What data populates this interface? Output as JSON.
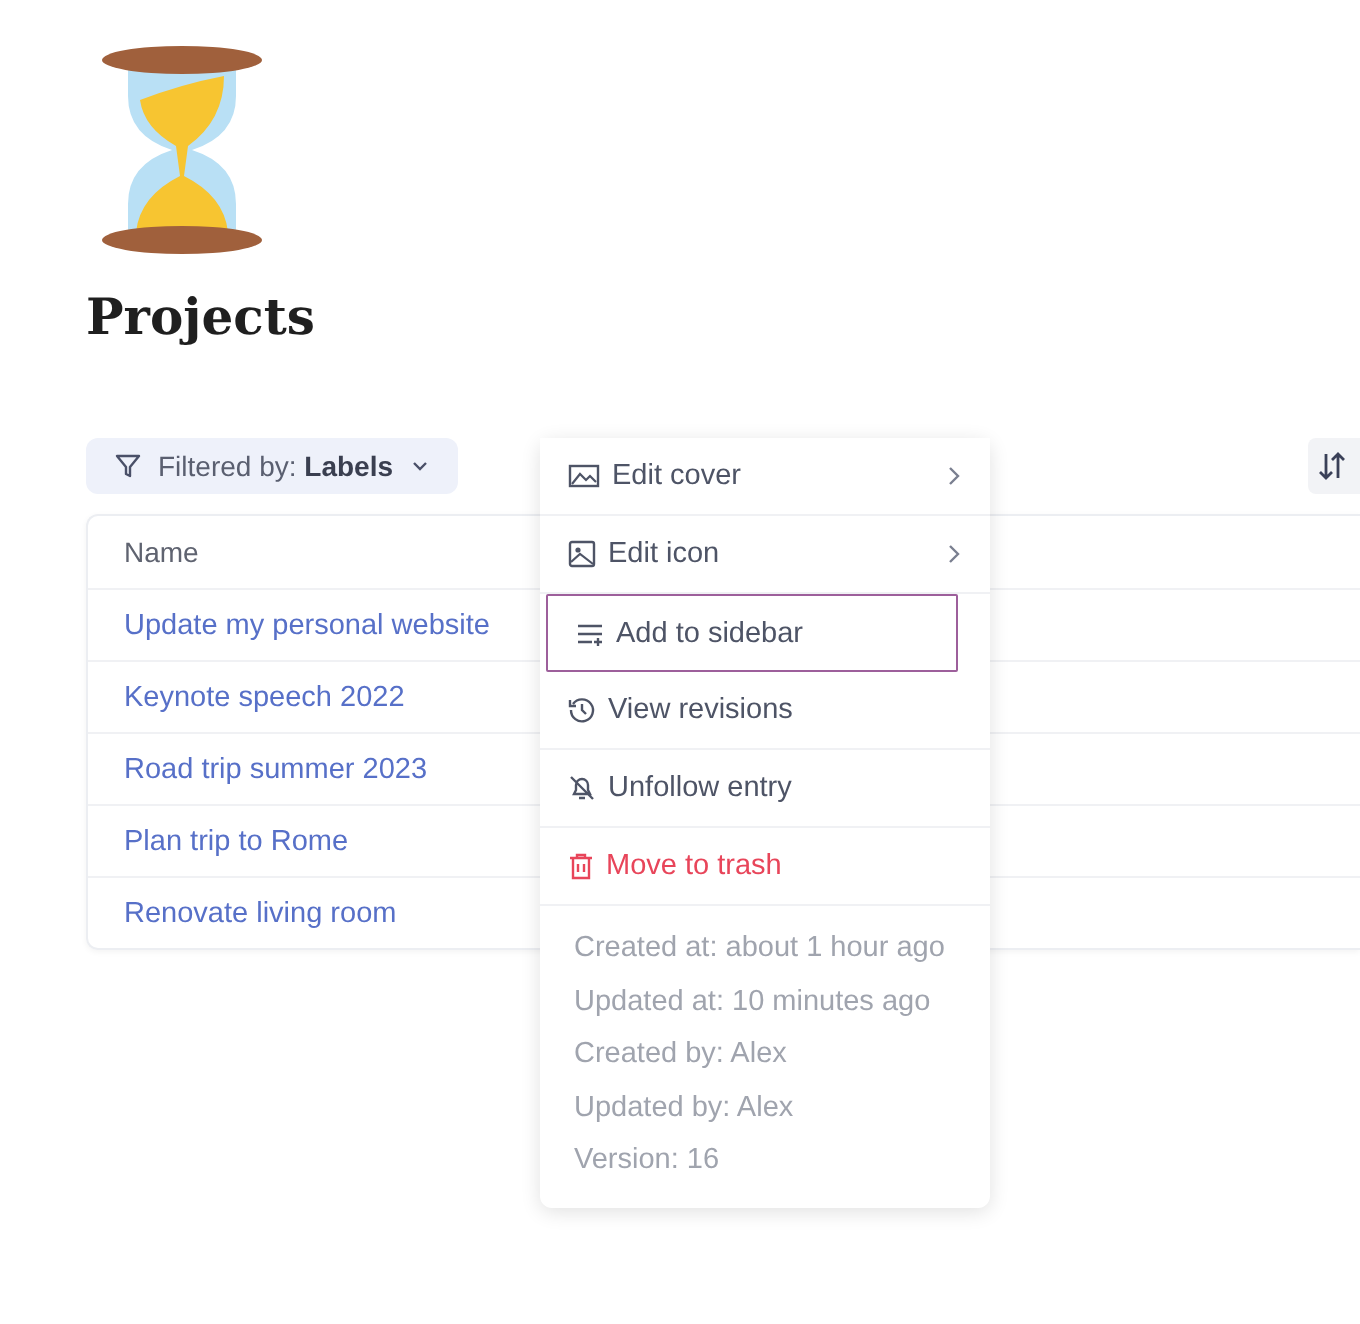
{
  "page": {
    "title": "Projects"
  },
  "filter": {
    "label": "Filtered by: **Labels**"
  },
  "table": {
    "columns": [
      "Name"
    ],
    "rows": [
      "Update my personal website",
      "Keynote speech 2022",
      "Road trip summer 2023",
      "Plan trip to Rome",
      "Renovate living room"
    ]
  },
  "menu": {
    "items": [
      {
        "label": "Edit cover",
        "kind": "submenu",
        "selected": false
      },
      {
        "label": "Edit icon",
        "kind": "submenu",
        "selected": false
      },
      {
        "label": "Add to sidebar",
        "kind": "item",
        "selected": true
      },
      {
        "label": "View revisions",
        "kind": "item",
        "selected": false
      },
      {
        "label": "Unfollow entry",
        "kind": "item",
        "selected": false
      },
      {
        "label": "Move to trash",
        "kind": "danger",
        "selected": false
      }
    ],
    "info": [
      "Created at: about 1 hour ago",
      "Updated at: 10 minutes ago",
      "Created by: Alex",
      "Updated by: Alex",
      "Version: 16"
    ]
  }
}
